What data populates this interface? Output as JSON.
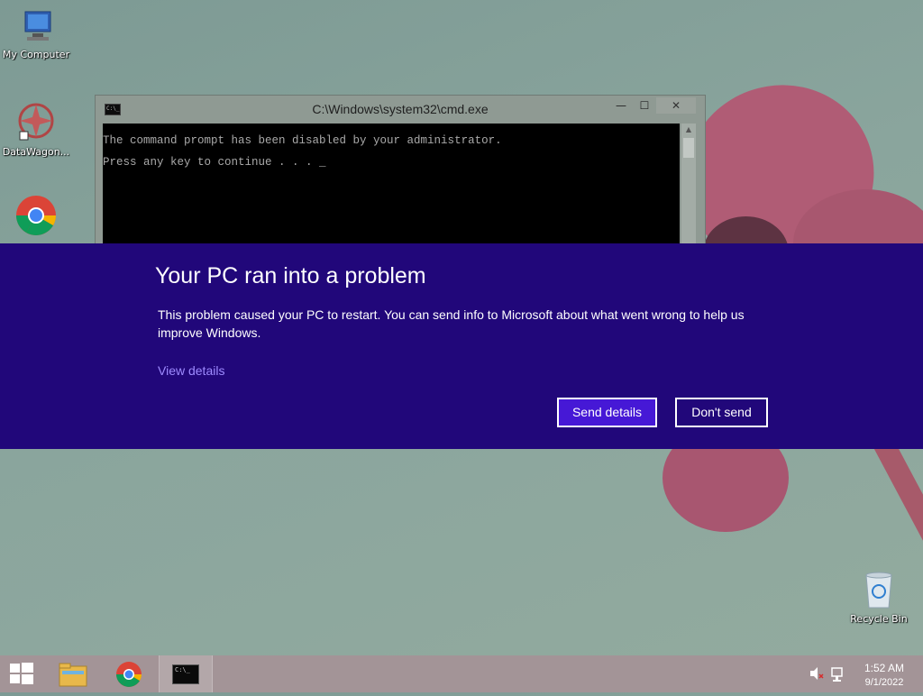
{
  "desktop": {
    "icons": [
      {
        "label": "My Computer",
        "icon": "computer-icon"
      },
      {
        "label": "DataWagon...",
        "icon": "datawagon-icon"
      },
      {
        "label": "",
        "icon": "chrome-icon"
      },
      {
        "label": "Recycle Bin",
        "icon": "recycle-bin-icon"
      }
    ]
  },
  "cmd_window": {
    "title": "C:\\Windows\\system32\\cmd.exe",
    "icon_text": "C:\\_",
    "minimize": "—",
    "maximize": "☐",
    "close": "✕",
    "lines": [
      "The command prompt has been disabled by your administrator.",
      "Press any key to continue . . . _"
    ]
  },
  "error_dialog": {
    "title": "Your PC ran into a problem",
    "message": "This problem caused your PC to restart. You can send info to Microsoft about what went wrong to help us improve Windows.",
    "link": "View details",
    "send_button": "Send details",
    "dont_send_button": "Don't send"
  },
  "taskbar": {
    "items": [
      "start-icon",
      "file-explorer-icon",
      "chrome-icon",
      "cmd-icon"
    ],
    "cmd_icon_text": "C:\\_",
    "clock_time": "1:52 AM",
    "clock_date": "9/1/2022",
    "tray_icons": [
      "volume-muted-icon",
      "network-icon"
    ]
  },
  "colors": {
    "banner": "#21077a",
    "primary_button": "#4618d6",
    "link": "#9e8bff",
    "taskbar": "#a39497"
  }
}
